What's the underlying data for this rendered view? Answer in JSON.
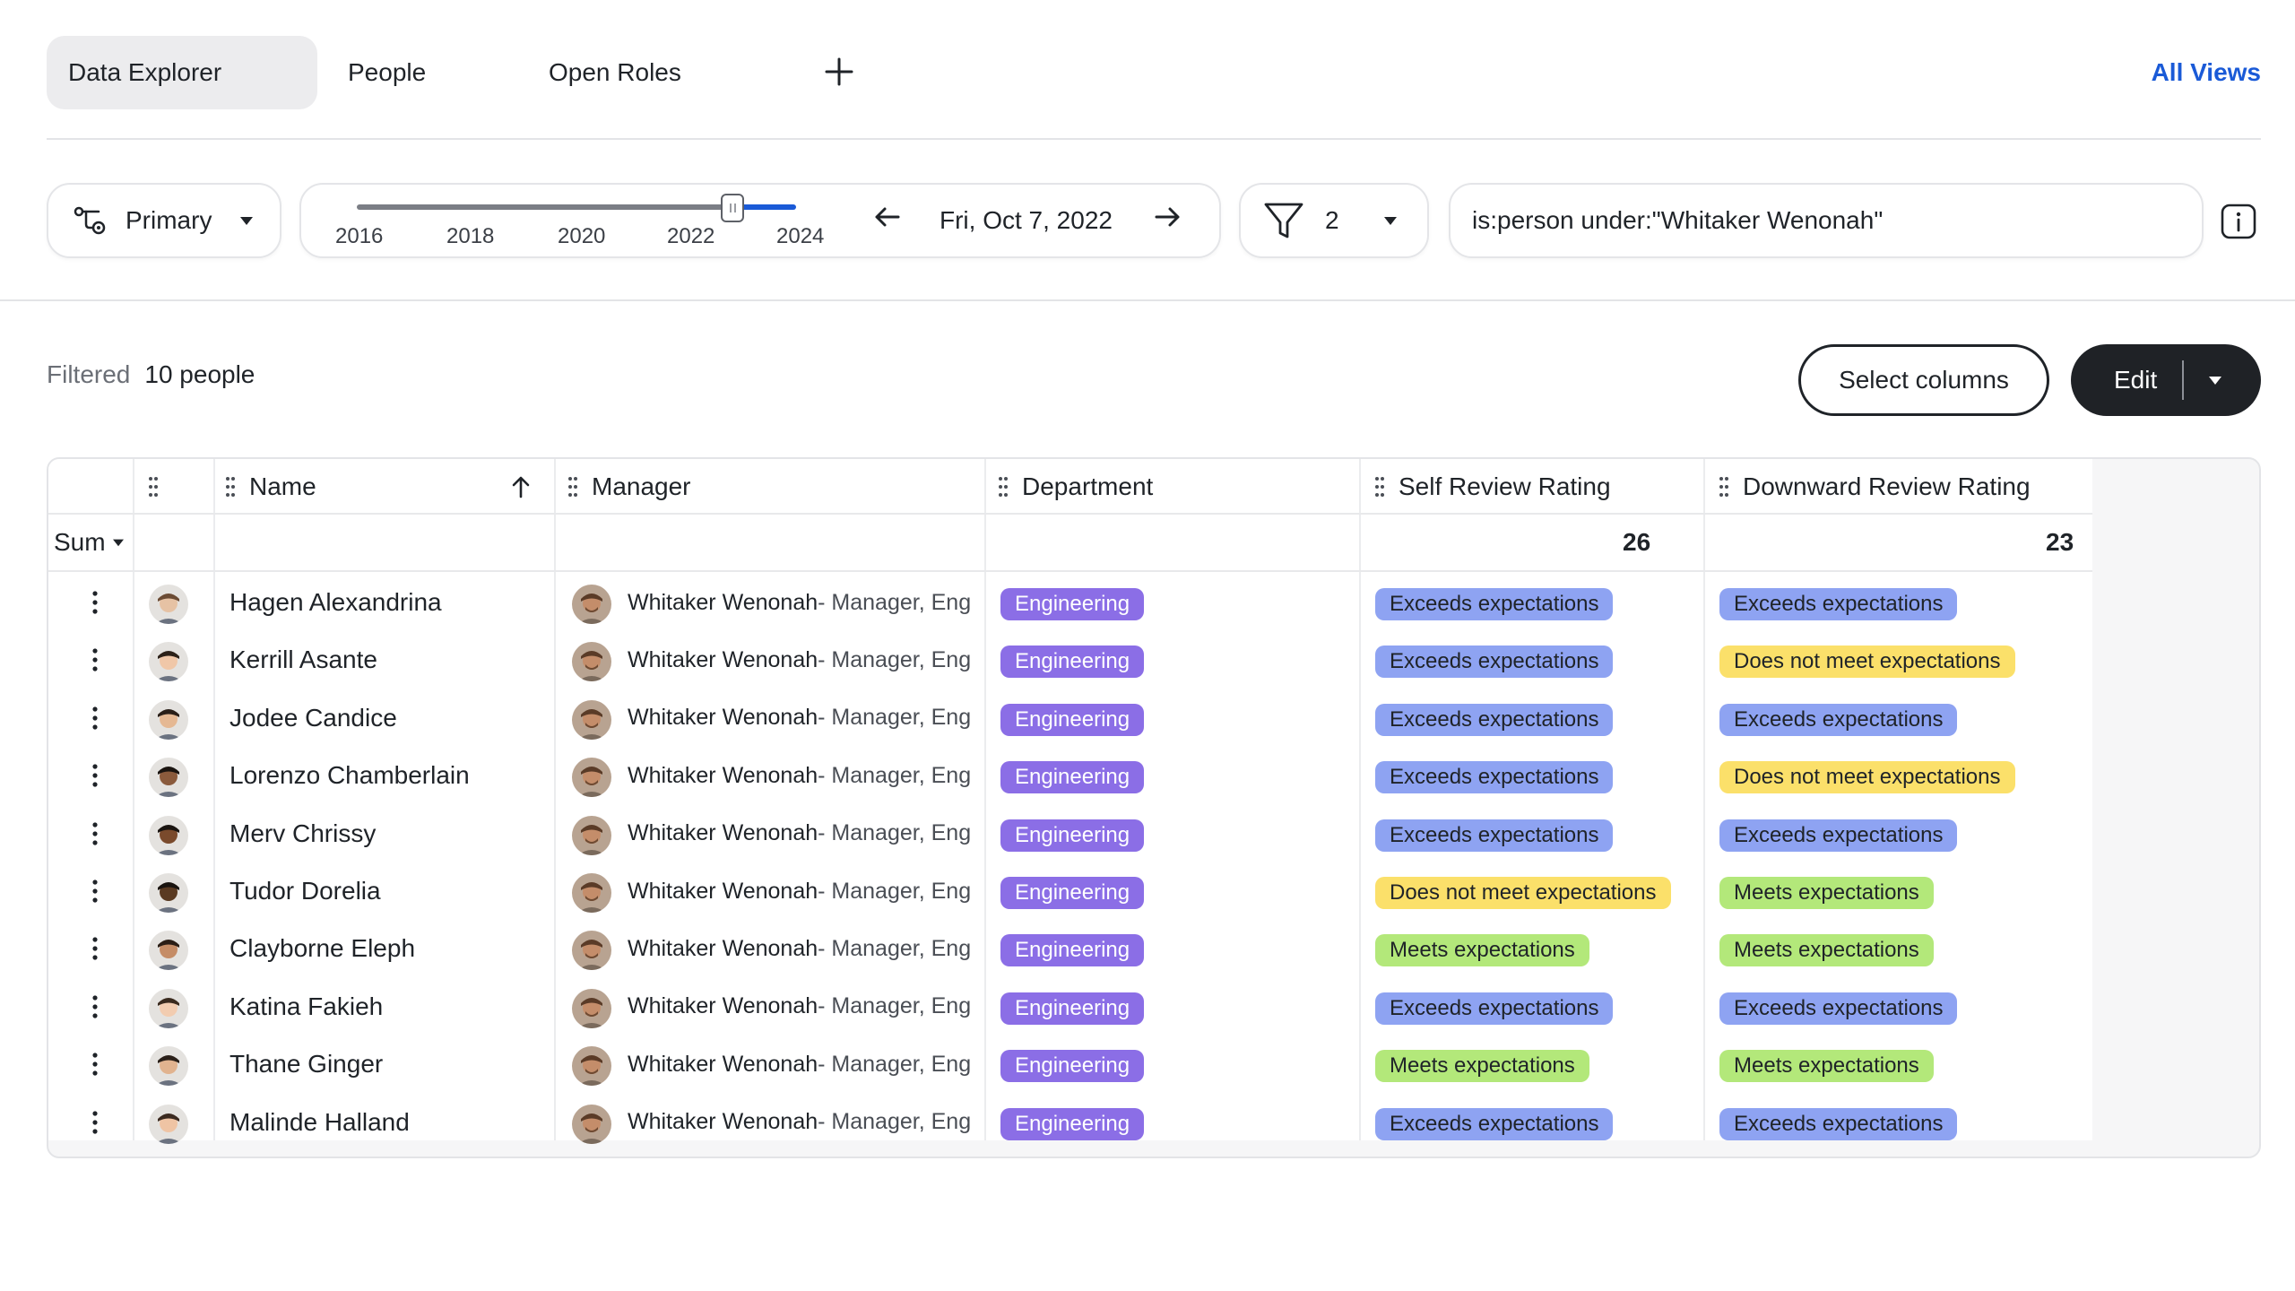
{
  "tabs": [
    {
      "label": "Data Explorer",
      "active": true
    },
    {
      "label": "People",
      "active": false
    },
    {
      "label": "Open Roles",
      "active": false
    }
  ],
  "all_views_label": "All Views",
  "toolbar": {
    "primary_label": "Primary",
    "timeline": {
      "years": [
        "2016",
        "2018",
        "2020",
        "2022",
        "2024"
      ],
      "date": "Fri, Oct 7, 2022"
    },
    "filter_count": "2",
    "query": "is:person under:\"Whitaker Wenonah\""
  },
  "summary": {
    "filtered_label": "Filtered",
    "count_label": "10 people"
  },
  "actions": {
    "select_columns": "Select columns",
    "edit": "Edit"
  },
  "columns": {
    "name": "Name",
    "manager": "Manager",
    "department": "Department",
    "self_review": "Self Review Rating",
    "downward_review": "Downward Review Rating"
  },
  "sum": {
    "label": "Sum",
    "self_review": "26",
    "downward_review": "23"
  },
  "rows": [
    {
      "name": "Hagen Alexandrina",
      "manager": "Whitaker Wenonah",
      "manager_role": " - Manager, Eng",
      "department": "Engineering",
      "self_review": "Exceeds expectations",
      "downward_review": "Exceeds expectations"
    },
    {
      "name": "Kerrill Asante",
      "manager": "Whitaker Wenonah",
      "manager_role": " - Manager, Eng",
      "department": "Engineering",
      "self_review": "Exceeds expectations",
      "downward_review": "Does not meet expectations"
    },
    {
      "name": "Jodee Candice",
      "manager": "Whitaker Wenonah",
      "manager_role": " - Manager, Eng",
      "department": "Engineering",
      "self_review": "Exceeds expectations",
      "downward_review": "Exceeds expectations"
    },
    {
      "name": "Lorenzo Chamberlain",
      "manager": "Whitaker Wenonah",
      "manager_role": " - Manager, Eng",
      "department": "Engineering",
      "self_review": "Exceeds expectations",
      "downward_review": "Does not meet expectations"
    },
    {
      "name": "Merv Chrissy",
      "manager": "Whitaker Wenonah",
      "manager_role": " - Manager, Eng",
      "department": "Engineering",
      "self_review": "Exceeds expectations",
      "downward_review": "Exceeds expectations"
    },
    {
      "name": "Tudor Dorelia",
      "manager": "Whitaker Wenonah",
      "manager_role": " - Manager, Eng",
      "department": "Engineering",
      "self_review": "Does not meet expectations",
      "downward_review": "Meets expectations"
    },
    {
      "name": "Clayborne Eleph",
      "manager": "Whitaker Wenonah",
      "manager_role": " - Manager, Eng",
      "department": "Engineering",
      "self_review": "Meets expectations",
      "downward_review": "Meets expectations"
    },
    {
      "name": "Katina Fakieh",
      "manager": "Whitaker Wenonah",
      "manager_role": " - Manager, Eng",
      "department": "Engineering",
      "self_review": "Exceeds expectations",
      "downward_review": "Exceeds expectations"
    },
    {
      "name": "Thane Ginger",
      "manager": "Whitaker Wenonah",
      "manager_role": " - Manager, Eng",
      "department": "Engineering",
      "self_review": "Meets expectations",
      "downward_review": "Meets expectations"
    },
    {
      "name": "Malinde Halland",
      "manager": "Whitaker Wenonah",
      "manager_role": " - Manager, Eng",
      "department": "Engineering",
      "self_review": "Exceeds expectations",
      "downward_review": "Exceeds expectations"
    }
  ],
  "colors": {
    "accent": "#1a5ad7",
    "department_tag": "#8b6ee6",
    "exceeds": "#8ea3f2",
    "meets": "#b3e87a",
    "does_not_meet": "#fbe06a"
  }
}
